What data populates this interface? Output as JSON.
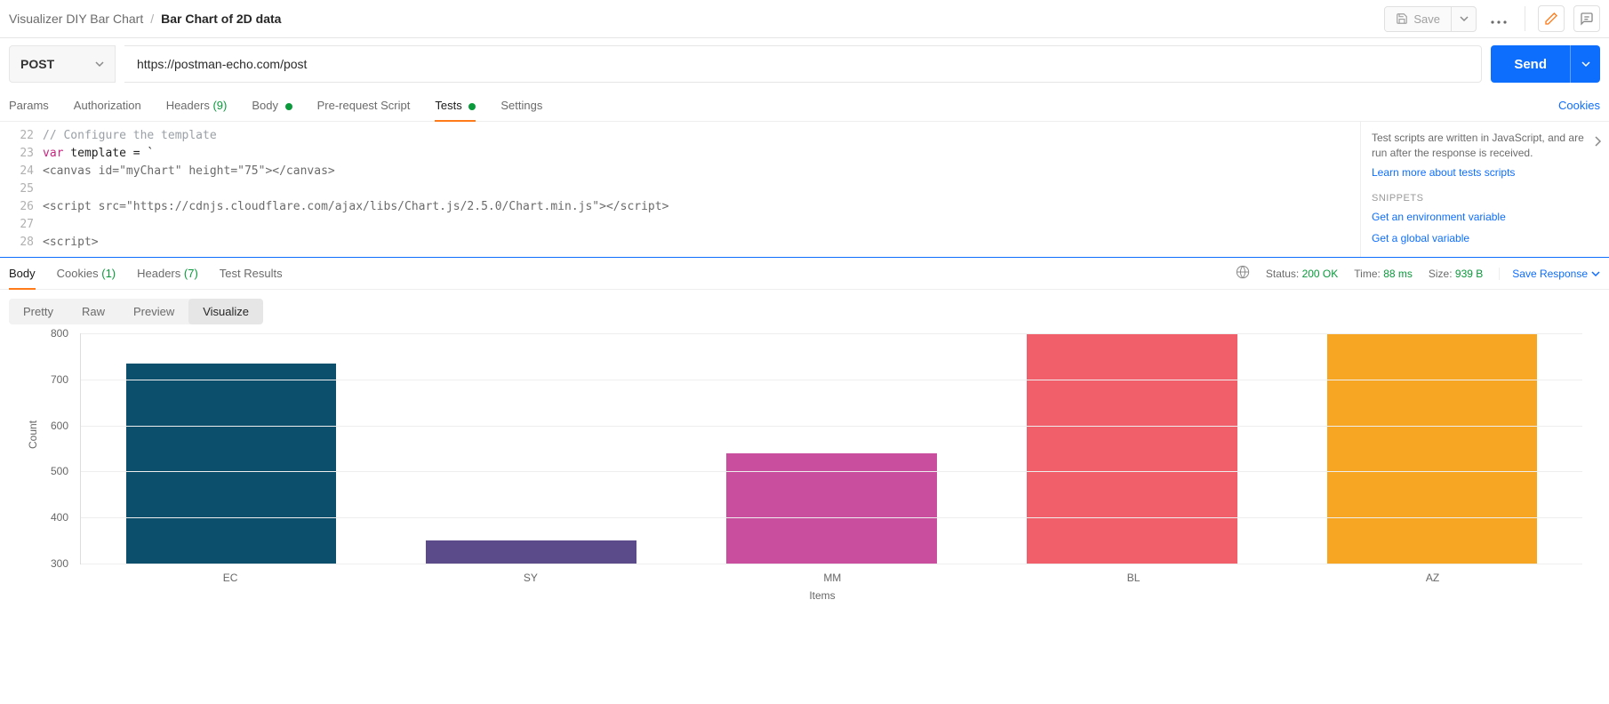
{
  "breadcrumb": {
    "parent": "Visualizer DIY Bar Chart",
    "sep": "/",
    "current": "Bar Chart of 2D data"
  },
  "topbar": {
    "save": "Save"
  },
  "request": {
    "method": "POST",
    "url": "https://postman-echo.com/post",
    "send": "Send"
  },
  "reqTabs": {
    "params": "Params",
    "authorization": "Authorization",
    "headers": "Headers",
    "headers_count": "(9)",
    "body": "Body",
    "prerequest": "Pre-request Script",
    "tests": "Tests",
    "settings": "Settings",
    "cookies": "Cookies"
  },
  "editor": {
    "lines": [
      "22",
      "23",
      "24",
      "25",
      "26",
      "27",
      "28"
    ],
    "code": {
      "l22_comment": "// Configure the template",
      "l23_kw": "var",
      "l23_rest": " template = `",
      "l24": "<canvas id=\"myChart\" height=\"75\"></canvas>",
      "l26": "<script src=\"https://cdnjs.cloudflare.com/ajax/libs/Chart.js/2.5.0/Chart.min.js\"></script>",
      "l28": "<script>"
    }
  },
  "sidebar": {
    "desc": "Test scripts are written in JavaScript, and are run after the response is received.",
    "learn": "Learn more about tests scripts",
    "snippets_hdr": "SNIPPETS",
    "snip1": "Get an environment variable",
    "snip2": "Get a global variable"
  },
  "respTabs": {
    "body": "Body",
    "cookies": "Cookies",
    "cookies_count": "(1)",
    "headers": "Headers",
    "headers_count": "(7)",
    "testresults": "Test Results"
  },
  "respMeta": {
    "status_label": "Status:",
    "status_val": "200 OK",
    "time_label": "Time:",
    "time_val": "88 ms",
    "size_label": "Size:",
    "size_val": "939 B",
    "save_response": "Save Response"
  },
  "viewModes": {
    "pretty": "Pretty",
    "raw": "Raw",
    "preview": "Preview",
    "visualize": "Visualize"
  },
  "chart_data": {
    "type": "bar",
    "categories": [
      "EC",
      "SY",
      "MM",
      "BL",
      "AZ"
    ],
    "values": [
      735,
      350,
      540,
      830,
      830
    ],
    "colors": [
      "#0b4f6c",
      "#5b4b8a",
      "#c94f9e",
      "#f15f6a",
      "#f6a623"
    ],
    "ylabel": "Count",
    "xlabel": "Items",
    "ylim": [
      300,
      800
    ],
    "yticks": [
      300,
      400,
      500,
      600,
      700,
      800
    ]
  }
}
